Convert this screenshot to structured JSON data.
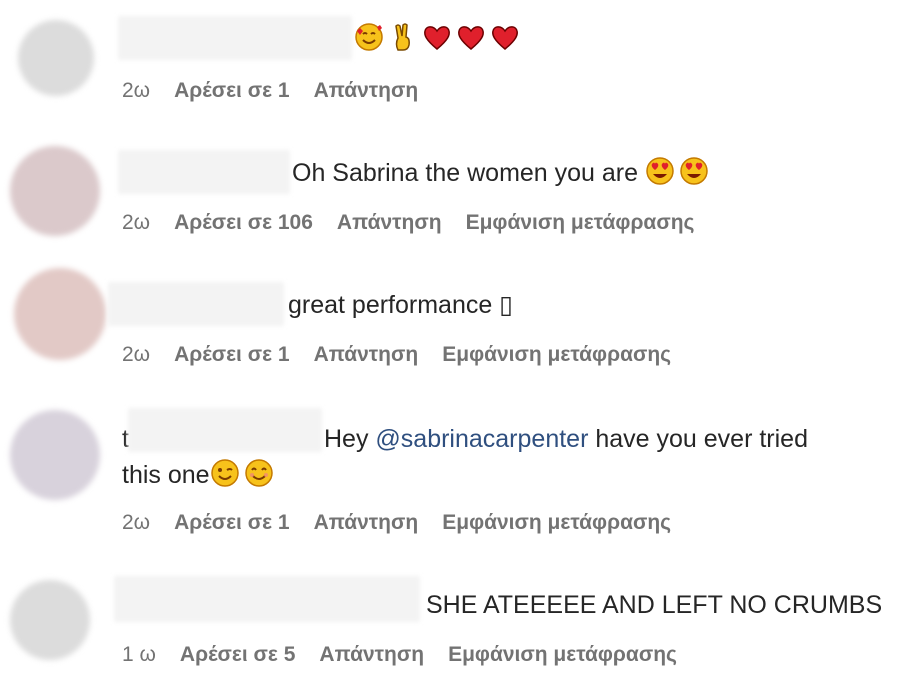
{
  "comments": [
    {
      "body_emojis": [
        "smiling-face-with-hearts",
        "victory-hand",
        "red-heart",
        "red-heart",
        "red-heart"
      ],
      "meta": {
        "time": "2ω",
        "likes": "Αρέσει σε 1",
        "reply": "Απάντηση"
      }
    },
    {
      "text": "Oh Sabrina the women you are",
      "body_emojis": [
        "heart-eyes",
        "heart-eyes"
      ],
      "meta": {
        "time": "2ω",
        "likes": "Αρέσει σε 106",
        "reply": "Απάντηση",
        "translate": "Εμφάνιση μετάφρασης"
      }
    },
    {
      "text": "great performance ▯",
      "meta": {
        "time": "2ω",
        "likes": "Αρέσει σε 1",
        "reply": "Απάντηση",
        "translate": "Εμφάνιση μετάφρασης"
      }
    },
    {
      "prefix": "t",
      "text_before": "Hey ",
      "mention": "@sabrinacarpenter",
      "text_after": " have you ever tried",
      "line2": "this one",
      "body_emojis": [
        "winking-face",
        "smiling-face"
      ],
      "meta": {
        "time": "2ω",
        "likes": "Αρέσει σε 1",
        "reply": "Απάντηση",
        "translate": "Εμφάνιση μετάφρασης"
      }
    },
    {
      "text": "SHE ATEEEEE AND LEFT NO CRUMBS",
      "meta": {
        "time": "1 ω",
        "likes": "Αρέσει σε 5",
        "reply": "Απάντηση",
        "translate": "Εμφάνιση μετάφρασης"
      }
    }
  ],
  "colors": {
    "text": "#262626",
    "meta": "#737373",
    "mention": "#2f4f7f",
    "heart": "#e0202c"
  }
}
